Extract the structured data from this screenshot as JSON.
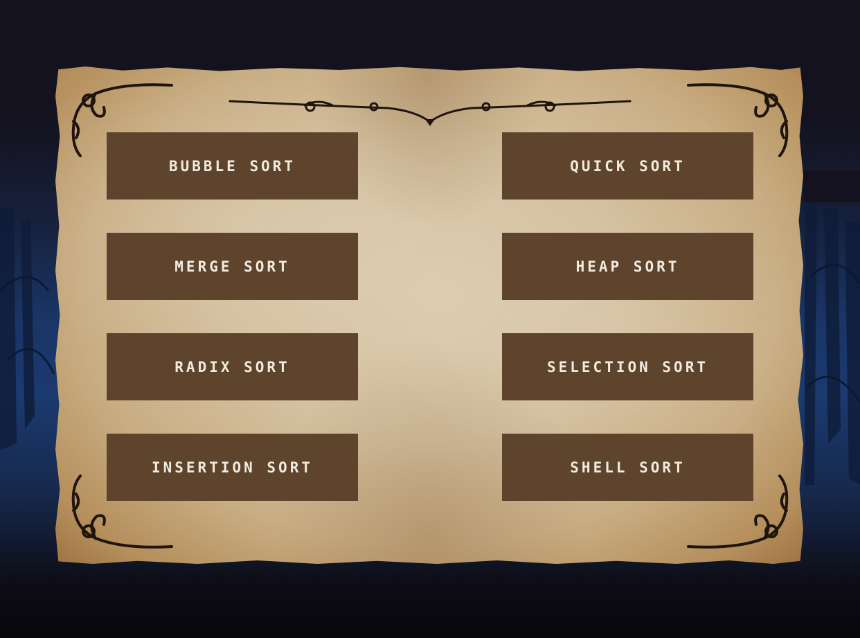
{
  "menu": {
    "buttons": [
      {
        "label": "BUBBLE SORT"
      },
      {
        "label": "QUICK SORT"
      },
      {
        "label": "MERGE SORT"
      },
      {
        "label": "HEAP SORT"
      },
      {
        "label": "RADIX SORT"
      },
      {
        "label": "SELECTION SORT"
      },
      {
        "label": "INSERTION SORT"
      },
      {
        "label": "SHELL SORT"
      }
    ]
  },
  "colors": {
    "button_bg": "#5e442c",
    "button_text": "#f1ebe0",
    "parchment": "#d4c1a0",
    "background_top": "#14121f",
    "background_forest": "#1a3566"
  },
  "icons": {
    "corner_ornaments": "flourish-icon",
    "top_divider": "scroll-divider-icon"
  }
}
